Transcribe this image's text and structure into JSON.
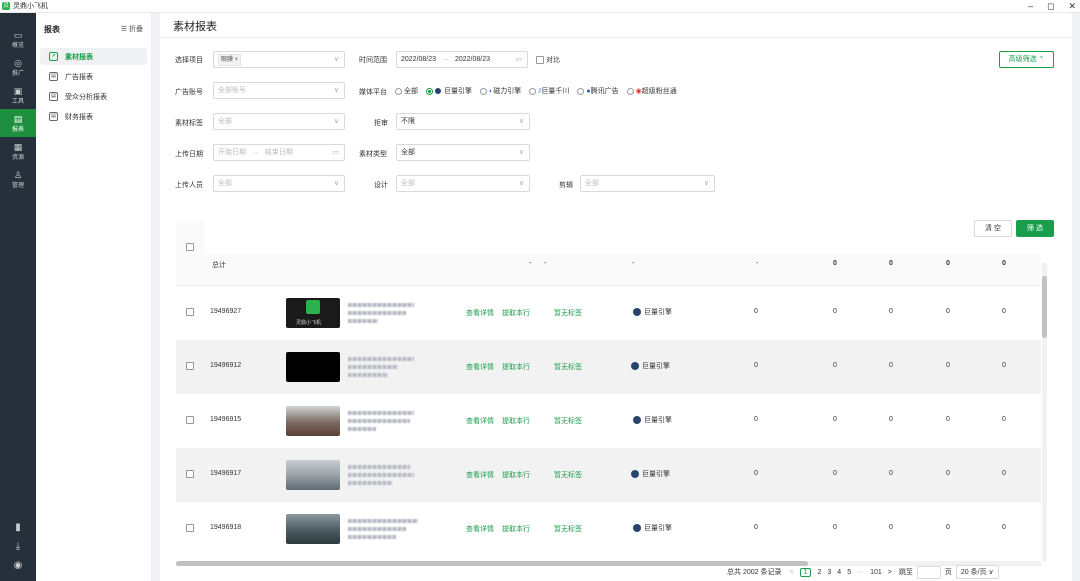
{
  "app": {
    "title": "灵鼎小飞机",
    "logo": "灵"
  },
  "window": {
    "minimize": "–",
    "restore": "◻",
    "close": "✕"
  },
  "leftnav": [
    {
      "label": "概览",
      "icon": "monitor-icon",
      "glyph": "▭"
    },
    {
      "label": "推广",
      "icon": "target-icon",
      "glyph": "◎"
    },
    {
      "label": "工具",
      "icon": "toolbox-icon",
      "glyph": "▣"
    },
    {
      "label": "报表",
      "icon": "report-icon",
      "glyph": "▤"
    },
    {
      "label": "资源",
      "icon": "archive-icon",
      "glyph": "▦"
    },
    {
      "label": "管理",
      "icon": "user-manage-icon",
      "glyph": "♙"
    }
  ],
  "leftnav_bottom": [
    {
      "icon": "book-icon",
      "glyph": "▮"
    },
    {
      "icon": "download-icon",
      "glyph": "⤓"
    },
    {
      "icon": "user-avatar-icon",
      "glyph": "◉"
    }
  ],
  "subnav": {
    "title": "报表",
    "fold": "折叠",
    "fold_glyph": "☰",
    "items": [
      {
        "label": "素材报表",
        "icon": "chart-icon",
        "glyph": "↗"
      },
      {
        "label": "广告报表",
        "icon": "ad-report-icon",
        "glyph": "▤"
      },
      {
        "label": "受众分析报表",
        "icon": "audience-icon",
        "glyph": "▤"
      },
      {
        "label": "财务报表",
        "icon": "finance-icon",
        "glyph": "▤"
      }
    ]
  },
  "page": {
    "title": "素材报表"
  },
  "filters": {
    "project": {
      "label": "选择项目",
      "tag": "眼膜 ×"
    },
    "time": {
      "label": "时间范围",
      "start": "2022/08/23",
      "sep": "→",
      "end": "2022/08/23",
      "compare": "对比"
    },
    "advanced": "高级筛选 ⌃",
    "account": {
      "label": "广告账号",
      "placeholder": "全部账号"
    },
    "media": {
      "label": "媒体平台",
      "options": [
        "全部",
        "巨量引擎",
        "磁力引擎",
        "巨量千川",
        "腾讯广告",
        "超级粉丝通"
      ],
      "selected": "巨量引擎"
    },
    "material_tag": {
      "label": "素材标签",
      "placeholder": "全部"
    },
    "reject": {
      "label": "拒审",
      "value": "不限"
    },
    "upload_date": {
      "label": "上传日期",
      "start": "开始日期",
      "sep": "→",
      "end": "结束日期"
    },
    "material_type": {
      "label": "素材类型",
      "value": "全部"
    },
    "uploader": {
      "label": "上传人员",
      "placeholder": "全部"
    },
    "design": {
      "label": "设计",
      "placeholder": "全部"
    },
    "edit": {
      "label": "剪辑",
      "placeholder": "全部"
    },
    "clear": "清 空",
    "filter": "筛 选"
  },
  "table": {
    "total_label": "总计",
    "total_values": [
      "-",
      "-",
      "-",
      "-",
      "0",
      "0",
      "0",
      "0"
    ],
    "rows": [
      {
        "id": "19496927",
        "actions": [
          "查看详情",
          "提取本行"
        ],
        "tag": "暂无标签",
        "platform": "巨量引擎",
        "values": [
          "0",
          "0",
          "0",
          "0",
          "0"
        ],
        "thumb_text": "灵鼎小飞机"
      },
      {
        "id": "19496912",
        "actions": [
          "查看详情",
          "提取本行"
        ],
        "tag": "暂无标签",
        "platform": "巨量引擎",
        "values": [
          "0",
          "0",
          "0",
          "0",
          "0"
        ],
        "thumb_text": ""
      },
      {
        "id": "19496915",
        "actions": [
          "查看详情",
          "提取本行"
        ],
        "tag": "暂无标签",
        "platform": "巨量引擎",
        "values": [
          "0",
          "0",
          "0",
          "0",
          "0"
        ],
        "thumb_text": ""
      },
      {
        "id": "19496917",
        "actions": [
          "查看详情",
          "提取本行"
        ],
        "tag": "暂无标签",
        "platform": "巨量引擎",
        "values": [
          "0",
          "0",
          "0",
          "0",
          "0"
        ],
        "thumb_text": ""
      },
      {
        "id": "19496918",
        "actions": [
          "查看详情",
          "提取本行"
        ],
        "tag": "暂无标签",
        "platform": "巨量引擎",
        "values": [
          "0",
          "0",
          "0",
          "0",
          "0"
        ],
        "thumb_text": ""
      }
    ]
  },
  "pagination": {
    "total": "总共 2002 条记录",
    "prev": "<",
    "pages": [
      "1",
      "2",
      "3",
      "4",
      "5"
    ],
    "current": "1",
    "ellipsis": "···",
    "last": "101",
    "next": ">",
    "jump": "跳至",
    "page_unit": "页",
    "size": "20 条/页 ∨"
  }
}
